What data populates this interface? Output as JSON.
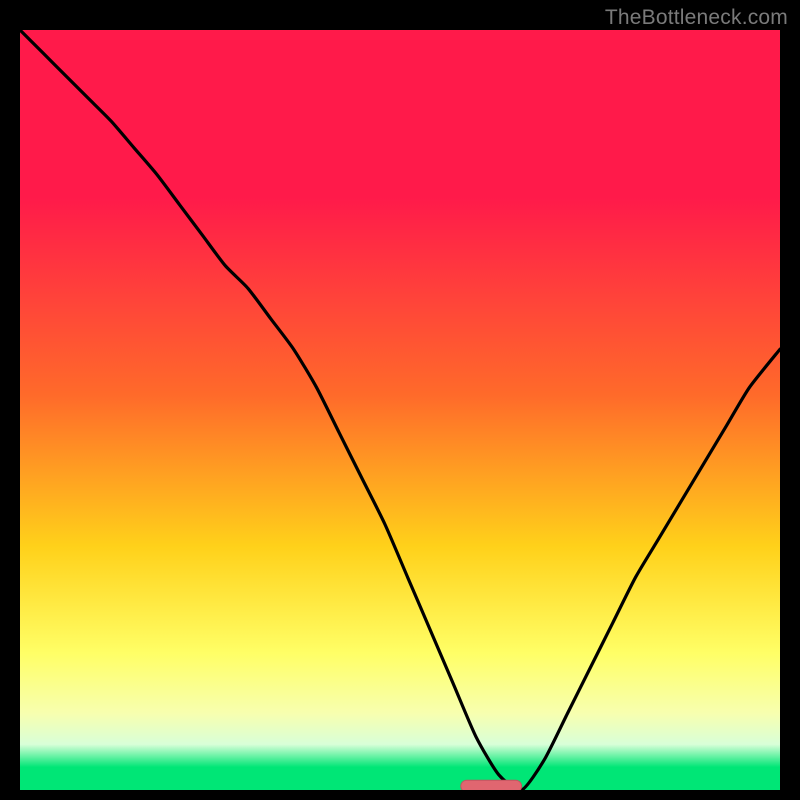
{
  "watermark": "TheBottleneck.com",
  "colors": {
    "frame_bg": "#000000",
    "gradient_top": "#ff1a4a",
    "gradient_mid1": "#ff6a2a",
    "gradient_mid2": "#ffd11a",
    "gradient_mid3": "#ffff66",
    "gradient_mid4": "#f7ffb0",
    "gradient_bottom_band": "#d8ffd8",
    "gradient_bottom": "#00e676",
    "curve_stroke": "#000000",
    "marker_fill": "#e06670",
    "marker_stroke": "#c05560"
  },
  "chart_data": {
    "type": "line",
    "title": "",
    "xlabel": "",
    "ylabel": "",
    "xlim": [
      0,
      100
    ],
    "ylim": [
      0,
      100
    ],
    "grid": false,
    "series": [
      {
        "name": "bottleneck-curve",
        "x": [
          0,
          3,
          6,
          9,
          12,
          15,
          18,
          21,
          24,
          27,
          30,
          33,
          36,
          39,
          42,
          45,
          48,
          51,
          54,
          57,
          60,
          63,
          66,
          69,
          72,
          75,
          78,
          81,
          84,
          87,
          90,
          93,
          96,
          100
        ],
        "values": [
          100,
          97,
          94,
          91,
          88,
          84.5,
          81,
          77,
          73,
          69,
          66,
          62,
          58,
          53,
          47,
          41,
          35,
          28,
          21,
          14,
          7,
          2,
          0,
          4,
          10,
          16,
          22,
          28,
          33,
          38,
          43,
          48,
          53,
          58
        ]
      }
    ],
    "marker": {
      "x_start": 58,
      "x_end": 66,
      "y": 0.5,
      "shape": "rounded-pill"
    },
    "gradient_stops_pct": [
      0,
      22,
      48,
      68,
      82,
      90,
      94,
      97,
      100
    ]
  }
}
